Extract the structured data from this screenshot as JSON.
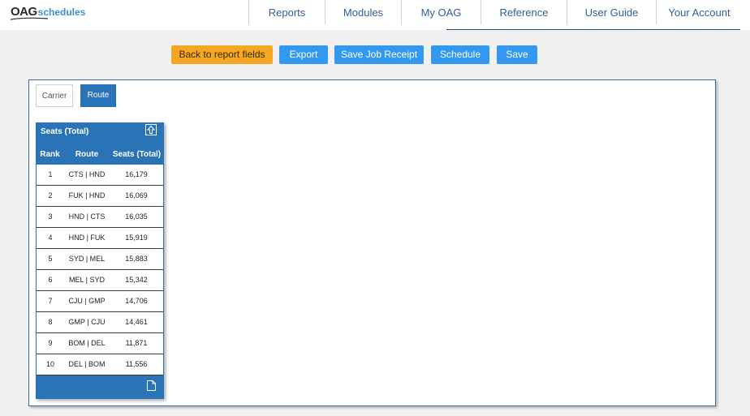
{
  "logo": {
    "part1": "OAG",
    "part2": "schedules"
  },
  "nav": {
    "items": [
      {
        "label": "Reports"
      },
      {
        "label": "Modules"
      },
      {
        "label": "My OAG"
      },
      {
        "label": "Reference"
      },
      {
        "label": "User Guide"
      },
      {
        "label": "Your Account"
      }
    ]
  },
  "actions": {
    "back": "Back to report fields",
    "export": "Export",
    "save_receipt": "Save Job Receipt",
    "schedule": "Schedule",
    "save": "Save"
  },
  "tabs": {
    "carrier": "Carrier",
    "route": "Route",
    "active": "Route"
  },
  "table": {
    "title": "Seats (Total)",
    "headers": {
      "rank": "Rank",
      "route": "Route",
      "seats": "Seats (Total)"
    },
    "rows": [
      {
        "rank": "1",
        "route": "CTS | HND",
        "seats": "16,179"
      },
      {
        "rank": "2",
        "route": "FUK | HND",
        "seats": "16,069"
      },
      {
        "rank": "3",
        "route": "HND | CTS",
        "seats": "16,035"
      },
      {
        "rank": "4",
        "route": "HND | FUK",
        "seats": "15,919"
      },
      {
        "rank": "5",
        "route": "SYD | MEL",
        "seats": "15,883"
      },
      {
        "rank": "6",
        "route": "MEL | SYD",
        "seats": "15,342"
      },
      {
        "rank": "7",
        "route": "CJU | GMP",
        "seats": "14,706"
      },
      {
        "rank": "8",
        "route": "GMP | CJU",
        "seats": "14,461"
      },
      {
        "rank": "9",
        "route": "BOM | DEL",
        "seats": "11,871"
      },
      {
        "rank": "10",
        "route": "DEL | BOM",
        "seats": "11,556"
      }
    ]
  },
  "colors": {
    "brand_blue": "#2a73b6",
    "button_blue": "#3399ee",
    "button_orange": "#f5a623",
    "nav_text": "#2f5f9a"
  },
  "icons": {
    "table_export": "export-up-arrow-icon",
    "table_footer": "document-icon"
  }
}
